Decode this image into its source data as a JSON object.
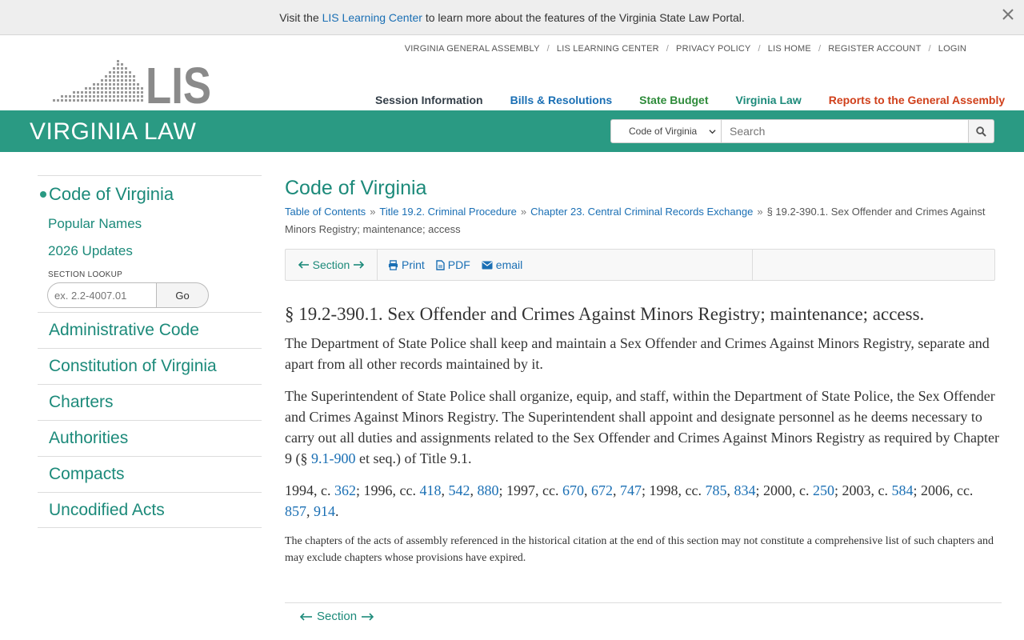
{
  "banner": {
    "prefix": "Visit the",
    "link": "LIS Learning Center",
    "suffix": "to learn more about the features of the Virginia State Law Portal."
  },
  "top_links": [
    "VIRGINIA GENERAL ASSEMBLY",
    "LIS LEARNING CENTER",
    "PRIVACY POLICY",
    "LIS HOME",
    "REGISTER ACCOUNT",
    "LOGIN"
  ],
  "logo": {
    "text": "LIS"
  },
  "main_nav": {
    "session": "Session Information",
    "bills": "Bills & Resolutions",
    "budget": "State Budget",
    "law": "Virginia Law",
    "reports": "Reports to the General Assembly"
  },
  "section_bar": {
    "title": "VIRGINIA LAW",
    "search_scope": "Code of Virginia",
    "search_placeholder": "Search"
  },
  "sidebar": {
    "active": "Code of Virginia",
    "sub_items": [
      "Popular Names",
      "2026 Updates"
    ],
    "lookup_label": "SECTION LOOKUP",
    "lookup_placeholder": "ex. 2.2-4007.01",
    "lookup_button": "Go",
    "items": [
      "Administrative Code",
      "Constitution of Virginia",
      "Charters",
      "Authorities",
      "Compacts",
      "Uncodified Acts"
    ]
  },
  "content": {
    "title": "Code of Virginia",
    "breadcrumbs": {
      "toc": "Table of Contents",
      "title": "Title 19.2. Criminal Procedure",
      "chapter": "Chapter 23. Central Criminal Records Exchange",
      "current": "§ 19.2-390.1. Sex Offender and Crimes Against Minors Registry; maintenance; access"
    },
    "toolbar": {
      "section": "Section",
      "print": "Print",
      "pdf": "PDF",
      "email": "email"
    },
    "section_heading": "§ 19.2-390.1. Sex Offender and Crimes Against Minors Registry; maintenance; access.",
    "para1": "The Department of State Police shall keep and maintain a Sex Offender and Crimes Against Minors Registry, separate and apart from all other records maintained by it.",
    "para2_before": "The Superintendent of State Police shall organize, equip, and staff, within the Department of State Police, the Sex Offender and Crimes Against Minors Registry. The Superintendent shall appoint and designate personnel as he deems necessary to carry out all duties and assignments related to the Sex Offender and Crimes Against Minors Registry as required by Chapter 9 (§",
    "para2_link": "9.1-900",
    "para2_after": "et seq.) of Title 9.1.",
    "history": {
      "y1994": "1994, c.",
      "c362": "362",
      "y1996": "; 1996, cc.",
      "c418": "418",
      "c542": "542",
      "c880": "880",
      "y1997": "; 1997, cc.",
      "c670": "670",
      "c672": "672",
      "c747": "747",
      "y1998": "; 1998, cc.",
      "c785": "785",
      "c834": "834",
      "y2000": "; 2000, c.",
      "c250": "250",
      "y2003": "; 2003, c.",
      "c584": "584",
      "y2006": "; 2006, cc.",
      "c857": "857",
      "c914": "914",
      "end": "."
    },
    "note": "The chapters of the acts of assembly referenced in the historical citation at the end of this section may not constitute a comprehensive list of such chapters and may exclude chapters whose provisions have expired.",
    "bottom_nav": "Section"
  },
  "colors": {
    "green_bar": "#2a9a83",
    "law_green": "#1c8a7a",
    "link_blue": "#1a6fb4",
    "reports_red": "#d0401b"
  }
}
